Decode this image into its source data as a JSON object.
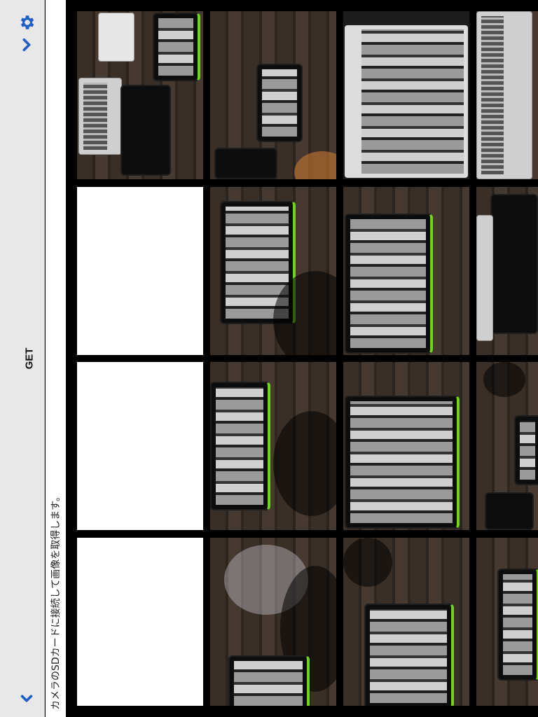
{
  "toolbar": {
    "get_label": "GET",
    "settings_icon": "gear-icon",
    "forward_icon": "chevron-right-icon",
    "collapse_icon": "chevron-down-icon",
    "accent": "#1f5fc6"
  },
  "info": {
    "message": "カメラのSDカードに接続して画像を取得します。"
  },
  "grid": {
    "columns": 4,
    "rows": 4,
    "blank_color": "#ffffff"
  }
}
